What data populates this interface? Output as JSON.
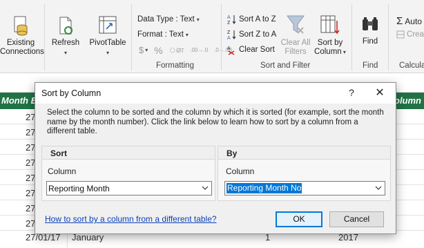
{
  "ribbon": {
    "existing_connections": "Existing\nConnections",
    "refresh": "Refresh",
    "pivottable": "PivotTable",
    "data_type": "Data Type : Text",
    "format": "Format : Text",
    "currency_symbol": "$",
    "percent_symbol": "%",
    "comma_symbol": "ௗ",
    "increase_decimal": ".00→.0",
    "decrease_decimal": ".0→.00",
    "formatting_group": "Formatting",
    "sort_a_to_z": "Sort A to Z",
    "sort_z_to_a": "Sort Z to A",
    "clear_sort": "Clear Sort",
    "clear_all_filters": "Clear All\nFilters",
    "sort_by_column": "Sort by\nColumn",
    "sort_and_filter_group": "Sort and Filter",
    "find": "Find",
    "find_group": "Find",
    "autosum": "Auto",
    "create": "Crea",
    "calculations_group": "Calcula"
  },
  "sheet": {
    "header_left": "Month E",
    "header_right": "olumn",
    "row_values": [
      "27",
      "27",
      "27",
      "27",
      "27",
      "27",
      "27",
      "27"
    ],
    "last_row": {
      "date": "27/01/17",
      "month": "January",
      "num": "1",
      "year": "2017"
    }
  },
  "dialog": {
    "title": "Sort by Column",
    "help": "?",
    "close": "✕",
    "description": "Select the column to be sorted and the column by which it is sorted (for example, sort the month name by the month number). Click the link below to learn how to sort by a column from a different table.",
    "sort_panel": {
      "heading": "Sort",
      "column_label": "Column",
      "column_value": "Reporting Month"
    },
    "by_panel": {
      "heading": "By",
      "column_label": "Column",
      "column_value": "Reporting Month No"
    },
    "help_link": "How to sort by a column from a different table?",
    "ok": "OK",
    "cancel": "Cancel"
  }
}
